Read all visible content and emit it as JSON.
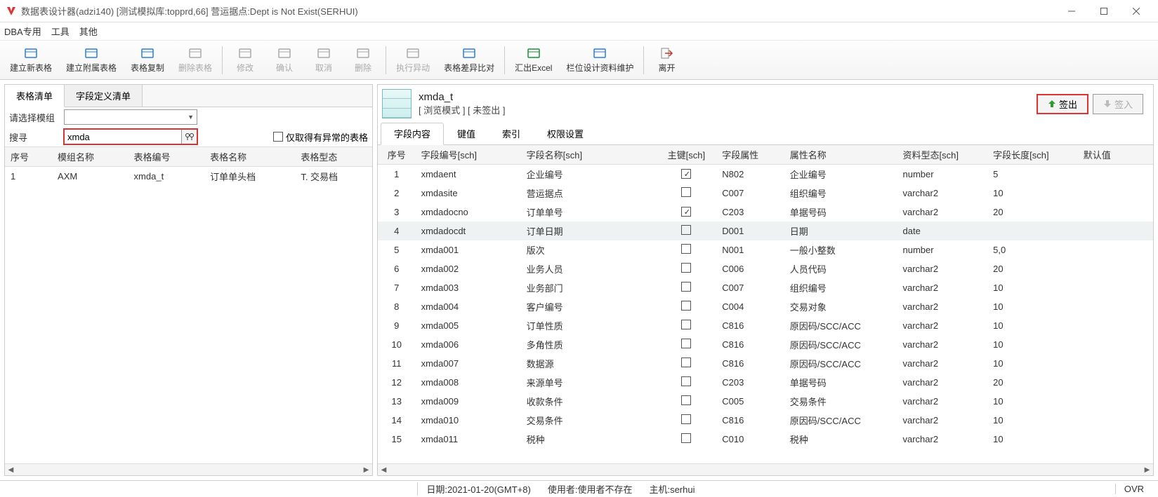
{
  "titlebar": {
    "text": "数据表设计器(adzi140)    [测试模拟库:topprd,66]    营运据点:Dept is Not Exist(SERHUI)"
  },
  "menu": {
    "items": [
      "DBA专用",
      "工具",
      "其他"
    ]
  },
  "toolbar": {
    "groups": [
      [
        {
          "name": "new-table",
          "label": "建立新表格",
          "color": "#2a7de1",
          "disabled": false
        },
        {
          "name": "new-sub-table",
          "label": "建立附属表格",
          "color": "#2a7de1",
          "disabled": false
        },
        {
          "name": "copy-table",
          "label": "表格复制",
          "color": "#2a7de1",
          "disabled": false
        },
        {
          "name": "delete-table",
          "label": "删除表格",
          "color": "#aaa",
          "disabled": true
        }
      ],
      [
        {
          "name": "modify",
          "label": "修改",
          "color": "#aaa",
          "disabled": true
        },
        {
          "name": "confirm",
          "label": "确认",
          "color": "#aaa",
          "disabled": true
        },
        {
          "name": "cancel",
          "label": "取消",
          "color": "#aaa",
          "disabled": true
        },
        {
          "name": "delete",
          "label": "删除",
          "color": "#aaa",
          "disabled": true
        }
      ],
      [
        {
          "name": "exec-diff",
          "label": "执行异动",
          "color": "#aaa",
          "disabled": true
        },
        {
          "name": "compare",
          "label": "表格差异比对",
          "color": "#2a7de1",
          "disabled": false
        }
      ],
      [
        {
          "name": "export-excel",
          "label": "汇出Excel",
          "color": "#1b8f3a",
          "disabled": false
        },
        {
          "name": "field-design",
          "label": "栏位设计资料维护",
          "color": "#2a7de1",
          "disabled": false
        }
      ],
      [
        {
          "name": "exit",
          "label": "离开",
          "color": "#c0392b",
          "disabled": false
        }
      ]
    ]
  },
  "left": {
    "tabs": [
      "表格清单",
      "字段定义清单"
    ],
    "module_label": "请选择模组",
    "search_label": "搜寻",
    "search_value": "xmda",
    "exception_only": "仅取得有异常的表格",
    "columns": [
      "序号",
      "模组名称",
      "表格编号",
      "表格名称",
      "表格型态"
    ],
    "rows": [
      {
        "seq": "1",
        "module": "AXM",
        "code": "xmda_t",
        "name": "订单单头档",
        "type": "T. 交易档"
      }
    ]
  },
  "right": {
    "title": "xmda_t",
    "subtitle": "[ 浏览模式 ] [ 未签出 ]",
    "checkout": "签出",
    "checkin": "签入",
    "sub_tabs": [
      "字段内容",
      "键值",
      "索引",
      "权限设置"
    ],
    "columns": [
      "序号",
      "字段编号[sch]",
      "字段名称[sch]",
      "主键[sch]",
      "字段属性",
      "属性名称",
      "资料型态[sch]",
      "字段长度[sch]",
      "默认值"
    ],
    "rows": [
      {
        "seq": "1",
        "code": "xmdaent",
        "name": "企业编号",
        "pk": true,
        "attr": "N802",
        "attrname": "企业编号",
        "type": "number",
        "len": "5",
        "def": ""
      },
      {
        "seq": "2",
        "code": "xmdasite",
        "name": "营运据点",
        "pk": false,
        "attr": "C007",
        "attrname": "组织编号",
        "type": "varchar2",
        "len": "10",
        "def": ""
      },
      {
        "seq": "3",
        "code": "xmdadocno",
        "name": "订单单号",
        "pk": true,
        "attr": "C203",
        "attrname": "单据号码",
        "type": "varchar2",
        "len": "20",
        "def": ""
      },
      {
        "seq": "4",
        "code": "xmdadocdt",
        "name": "订单日期",
        "pk": false,
        "attr": "D001",
        "attrname": "日期",
        "type": "date",
        "len": "",
        "def": ""
      },
      {
        "seq": "5",
        "code": "xmda001",
        "name": "版次",
        "pk": false,
        "attr": "N001",
        "attrname": "一般小整数",
        "type": "number",
        "len": "5,0",
        "def": ""
      },
      {
        "seq": "6",
        "code": "xmda002",
        "name": "业务人员",
        "pk": false,
        "attr": "C006",
        "attrname": "人员代码",
        "type": "varchar2",
        "len": "20",
        "def": ""
      },
      {
        "seq": "7",
        "code": "xmda003",
        "name": "业务部门",
        "pk": false,
        "attr": "C007",
        "attrname": "组织编号",
        "type": "varchar2",
        "len": "10",
        "def": ""
      },
      {
        "seq": "8",
        "code": "xmda004",
        "name": "客户编号",
        "pk": false,
        "attr": "C004",
        "attrname": "交易对象",
        "type": "varchar2",
        "len": "10",
        "def": ""
      },
      {
        "seq": "9",
        "code": "xmda005",
        "name": "订单性质",
        "pk": false,
        "attr": "C816",
        "attrname": "原因码/SCC/ACC",
        "type": "varchar2",
        "len": "10",
        "def": ""
      },
      {
        "seq": "10",
        "code": "xmda006",
        "name": "多角性质",
        "pk": false,
        "attr": "C816",
        "attrname": "原因码/SCC/ACC",
        "type": "varchar2",
        "len": "10",
        "def": ""
      },
      {
        "seq": "11",
        "code": "xmda007",
        "name": "数据源",
        "pk": false,
        "attr": "C816",
        "attrname": "原因码/SCC/ACC",
        "type": "varchar2",
        "len": "10",
        "def": ""
      },
      {
        "seq": "12",
        "code": "xmda008",
        "name": "来源单号",
        "pk": false,
        "attr": "C203",
        "attrname": "单据号码",
        "type": "varchar2",
        "len": "20",
        "def": ""
      },
      {
        "seq": "13",
        "code": "xmda009",
        "name": "收款条件",
        "pk": false,
        "attr": "C005",
        "attrname": "交易条件",
        "type": "varchar2",
        "len": "10",
        "def": ""
      },
      {
        "seq": "14",
        "code": "xmda010",
        "name": "交易条件",
        "pk": false,
        "attr": "C816",
        "attrname": "原因码/SCC/ACC",
        "type": "varchar2",
        "len": "10",
        "def": ""
      },
      {
        "seq": "15",
        "code": "xmda011",
        "name": "税种",
        "pk": false,
        "attr": "C010",
        "attrname": "税种",
        "type": "varchar2",
        "len": "10",
        "def": ""
      }
    ],
    "selected_row": 3
  },
  "status": {
    "date": "日期:2021-01-20(GMT+8)",
    "user": "使用者:使用者不存在",
    "host": "主机:serhui",
    "ovr": "OVR"
  }
}
